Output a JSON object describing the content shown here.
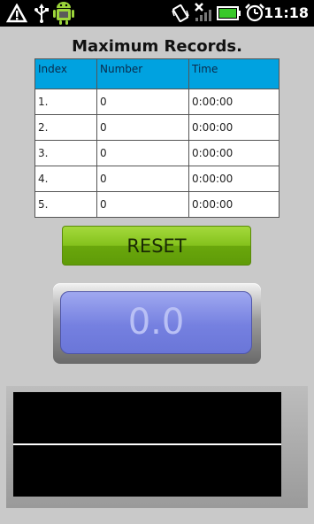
{
  "status_bar": {
    "time": "11:18",
    "icons": [
      "warning-icon",
      "usb-icon",
      "android-debug-icon",
      "vibrate-icon",
      "no-signal-icon",
      "battery-icon",
      "alarm-icon"
    ]
  },
  "title": "Maximum Records.",
  "table": {
    "headers": [
      "Index",
      "Number",
      "Time"
    ],
    "rows": [
      [
        "1.",
        "0",
        "0:00:00"
      ],
      [
        "2.",
        "0",
        "0:00:00"
      ],
      [
        "3.",
        "0",
        "0:00:00"
      ],
      [
        "4.",
        "0",
        "0:00:00"
      ],
      [
        "5.",
        "0",
        "0:00:00"
      ]
    ]
  },
  "reset_label": "RESET",
  "counter_value": "0.0",
  "colors": {
    "header_bg": "#00a2e0",
    "reset_green": "#84c21c",
    "counter_blue": "#7580e0"
  }
}
